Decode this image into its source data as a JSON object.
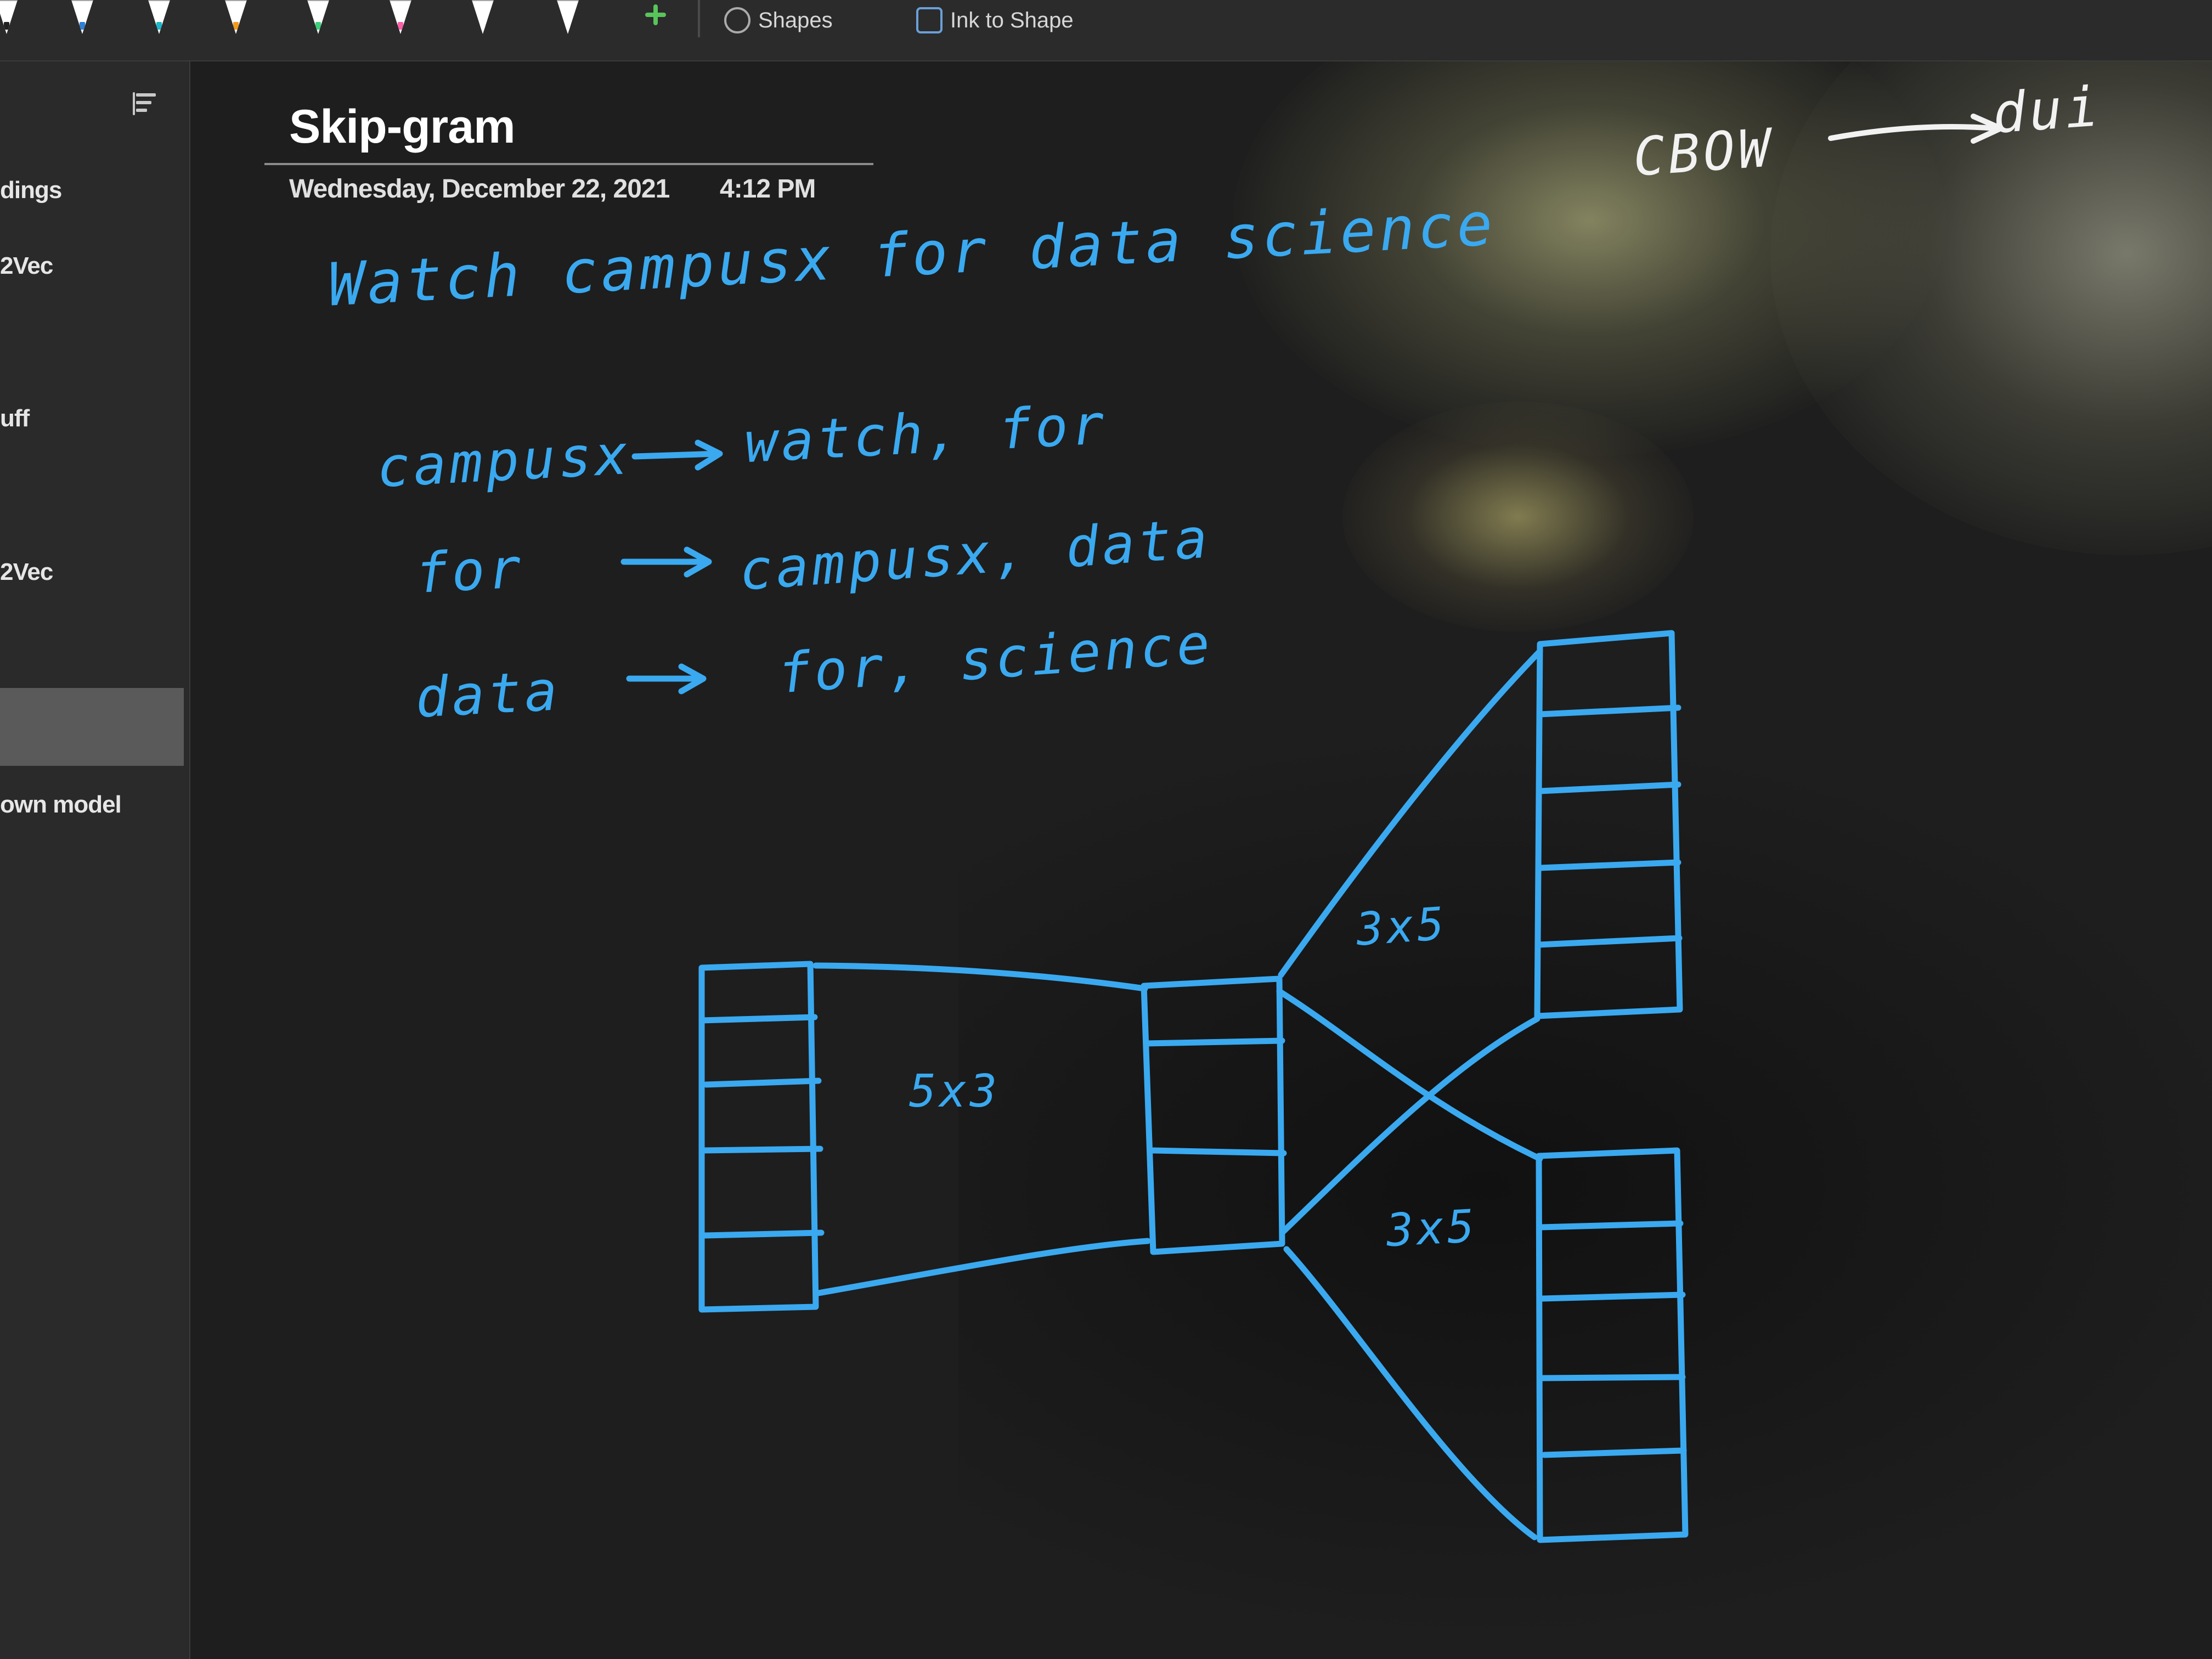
{
  "ribbon": {
    "pen_colors": [
      "#222222",
      "#2e7fd6",
      "#1fb5c8",
      "#f39a1e",
      "#ffcf3a",
      "#3fd07a",
      "#ff5fa8",
      "#b080e6",
      "#ffffff"
    ],
    "shapes_label": "Shapes",
    "ink_to_text_label": "Ink to Shape",
    "accent": "#58c45a"
  },
  "sidebar": {
    "items": [
      {
        "label": "dings"
      },
      {
        "label": "2Vec"
      },
      {
        "label": "uff"
      },
      {
        "label": "2Vec"
      },
      {
        "label": ""
      },
      {
        "label": "own model"
      }
    ],
    "selected_index": 4
  },
  "page": {
    "title": "Skip-gram",
    "date": "Wednesday, December 22, 2021",
    "time": "4:12 PM"
  },
  "handwriting": {
    "sentence": "Watch campusx for data science",
    "pairs": [
      {
        "word": "campusx",
        "context": "watch, for"
      },
      {
        "word": "for",
        "context": "campusx, data"
      },
      {
        "word": "data",
        "context": "for, science"
      }
    ],
    "top_right_left": "CBOW",
    "top_right_right": "dui",
    "labels": {
      "left_matrix": "5x3",
      "upper_matrix": "3x5",
      "lower_matrix": "3x5"
    },
    "ink_color": "#3aa9f0"
  }
}
